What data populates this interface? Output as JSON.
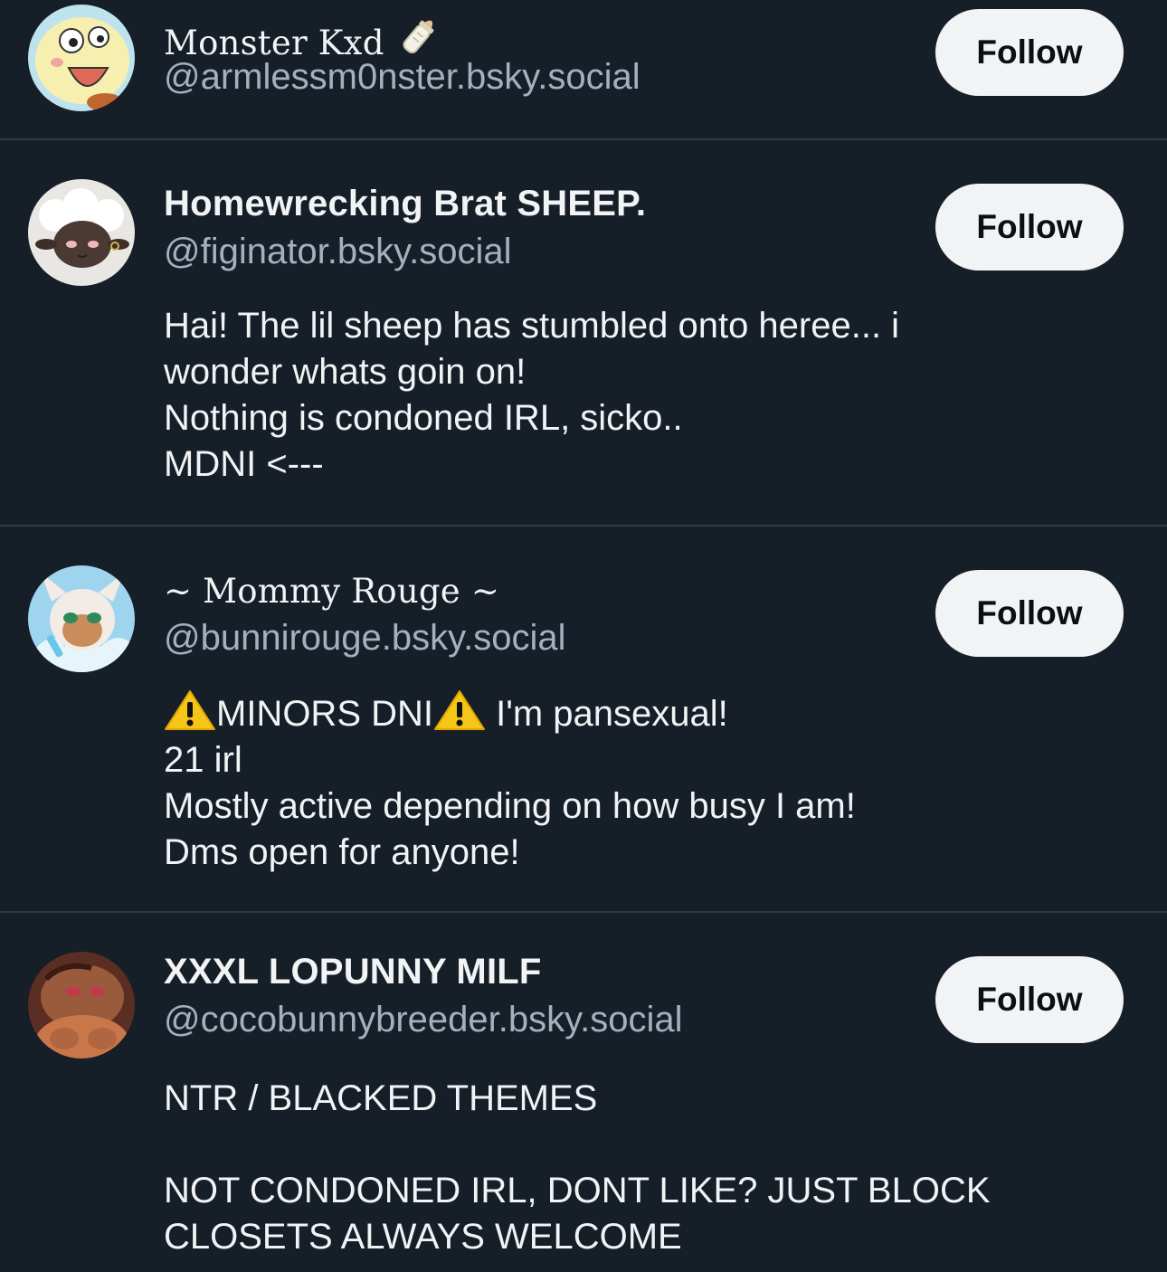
{
  "accounts": [
    {
      "display_name": "Monster Kxd",
      "name_emoji": "baby-bottle-icon",
      "handle": "@armlessm0nster.bsky.social",
      "follow_label": "Follow",
      "bio_lines": []
    },
    {
      "display_name": "Homewrecking Brat SHEEP.",
      "handle": "@figinator.bsky.social",
      "follow_label": "Follow",
      "bio_lines": [
        "Hai! The lil sheep has stumbled onto heree... i",
        "wonder whats goin on!",
        "Nothing is condoned IRL, sicko..",
        "MDNI <---"
      ]
    },
    {
      "display_name": "~ Mommy Rouge ~",
      "handle": "@bunnirouge.bsky.social",
      "follow_label": "Follow",
      "bio_first_line_text_a": "MINORS DNI",
      "bio_first_line_text_b": " I'm pansexual!",
      "bio_lines": [
        "21 irl",
        "Mostly active depending on how busy I am!",
        "Dms open for anyone!"
      ]
    },
    {
      "display_name": "XXXL LOPUNNY MILF",
      "handle": "@cocobunnybreeder.bsky.social",
      "follow_label": "Follow",
      "bio_lines": [
        "NTR / BLACKED THEMES",
        "",
        "NOT CONDONED IRL, DONT LIKE? JUST BLOCK",
        "CLOSETS ALWAYS WELCOME"
      ]
    }
  ],
  "colors": {
    "background": "#161e27",
    "divider": "#2e3a47",
    "text_primary": "#f1f3f5",
    "text_secondary": "#a3b1bf",
    "button_bg": "#f1f3f5",
    "button_text": "#0b0f14",
    "warning_yellow": "#f5c518"
  }
}
